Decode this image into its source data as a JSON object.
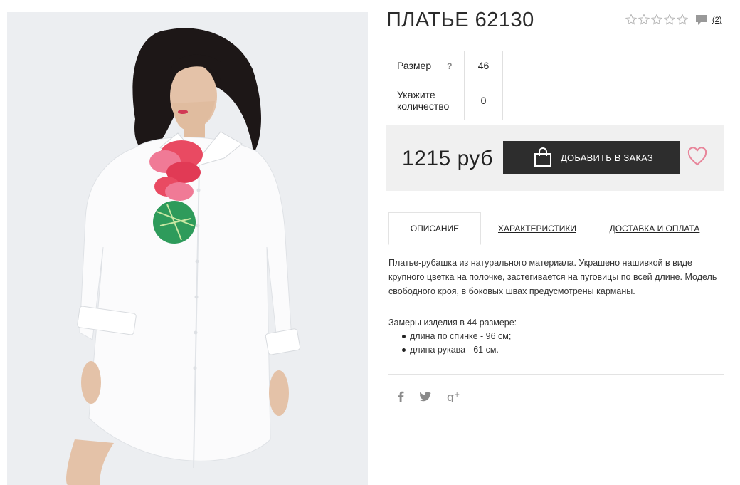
{
  "product": {
    "title": "ПЛАТЬЕ 62130",
    "rating_stars": 5,
    "comments_count": "(2)",
    "image_icon": "product-photo-white-shirt-dress"
  },
  "options": {
    "size_label": "Размер",
    "size_hint": "?",
    "size_value": "46",
    "qty_label": "Укажите количество",
    "qty_value": "0"
  },
  "purchase": {
    "price": "1215 руб",
    "add_button": "ДОБАВИТЬ В ЗАКАЗ",
    "button_color": "#2d2d2d",
    "heart_color": "#e8859a"
  },
  "tabs": [
    {
      "label": "ОПИСАНИЕ",
      "active": true
    },
    {
      "label": "ХАРАКТЕРИСТИКИ",
      "active": false
    },
    {
      "label": "ДОСТАВКА И ОПЛАТА",
      "active": false
    }
  ],
  "description": {
    "text": "Платье-рубашка из натурального материала. Украшено нашивкой в виде крупного цветка на полочке, застегивается на пуговицы по всей длине. Модель свободного кроя, в боковых швах предусмотрены карманы.",
    "measures_title": "Замеры изделия в 44 размере:",
    "measures": [
      "длина по спинке - 96 см;",
      "длина рукава - 61 см."
    ]
  },
  "social": [
    "facebook-icon",
    "twitter-icon",
    "google-plus-icon"
  ]
}
